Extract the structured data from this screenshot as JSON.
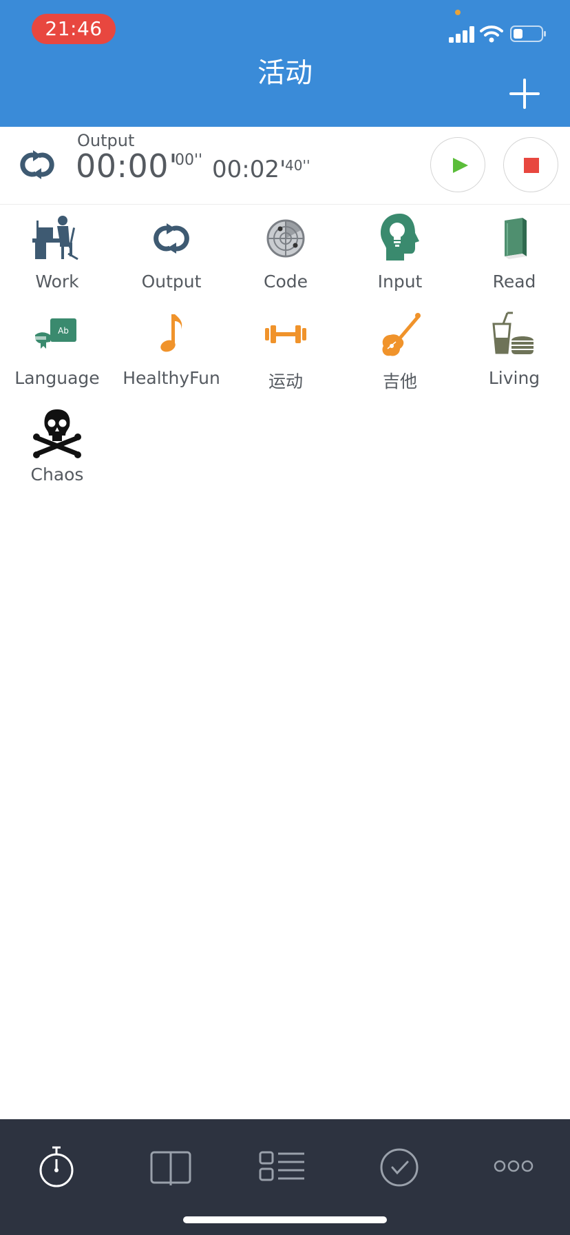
{
  "status_bar": {
    "time": "21:46",
    "icons": [
      "signal-icon",
      "wifi-icon",
      "battery-icon"
    ]
  },
  "header": {
    "title": "活动",
    "add_icon": "plus-icon"
  },
  "timer": {
    "label": "Output",
    "current_main": "00:00'",
    "current_sub": "00''",
    "total_main": "00:02'",
    "total_sub": "40''",
    "icon": "cycle-icon",
    "play_icon": "play-icon",
    "stop_icon": "stop-icon"
  },
  "activities": [
    {
      "label": "Work",
      "icon": "person-at-desk-icon"
    },
    {
      "label": "Output",
      "icon": "cycle-icon"
    },
    {
      "label": "Code",
      "icon": "radar-icon"
    },
    {
      "label": "Input",
      "icon": "head-lightbulb-icon"
    },
    {
      "label": "Read",
      "icon": "book-icon"
    },
    {
      "label": "Language",
      "icon": "language-book-icon"
    },
    {
      "label": "HealthyFun",
      "icon": "music-note-icon"
    },
    {
      "label": "运动",
      "icon": "dumbbell-icon"
    },
    {
      "label": "吉他",
      "icon": "violin-icon"
    },
    {
      "label": "Living",
      "icon": "drink-burger-icon"
    },
    {
      "label": "Chaos",
      "icon": "skull-crossbones-icon"
    }
  ],
  "tabbar": {
    "tabs": [
      {
        "icon": "stopwatch-icon",
        "active": true
      },
      {
        "icon": "open-book-icon",
        "active": false
      },
      {
        "icon": "list-icon",
        "active": false
      },
      {
        "icon": "checkmark-circle-icon",
        "active": false
      },
      {
        "icon": "more-icon",
        "active": false
      }
    ]
  },
  "colors": {
    "header_blue": "#3a8bd8",
    "time_pill_red": "#e8473f",
    "play_green": "#5bbd3a",
    "stop_red": "#e8473f",
    "tabbar_bg": "#2d3340",
    "icon_slate": "#3e5a72",
    "icon_orange": "#f0932b",
    "icon_green": "#3a8a6e"
  }
}
